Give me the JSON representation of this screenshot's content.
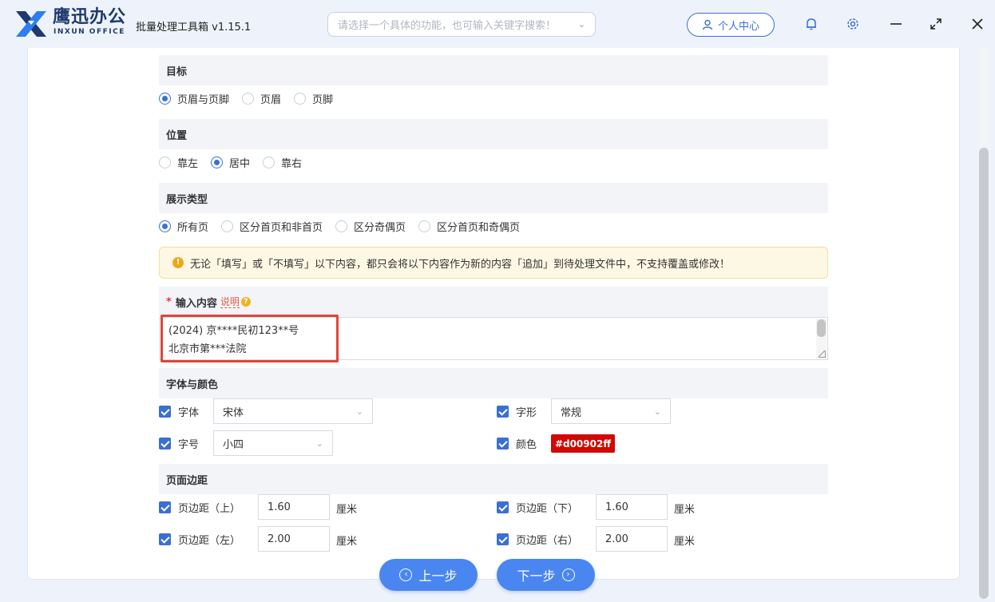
{
  "header": {
    "logo_cn": "鹰迅办公",
    "logo_en": "INXUN OFFICE",
    "app_name": "批量处理工具箱 v1.15.1",
    "search_placeholder": "请选择一个具体的功能，也可输入关键字搜索！",
    "user_center": "个人中心"
  },
  "target": {
    "title": "目标",
    "options": [
      "页眉与页脚",
      "页眉",
      "页脚"
    ],
    "selected": 0
  },
  "position": {
    "title": "位置",
    "options": [
      "靠左",
      "居中",
      "靠右"
    ],
    "selected": 1
  },
  "display_type": {
    "title": "展示类型",
    "options": [
      "所有页",
      "区分首页和非首页",
      "区分奇偶页",
      "区分首页和奇偶页"
    ],
    "selected": 0
  },
  "notice": "无论「填写」或「不填写」以下内容，都只会将以下内容作为新的内容「追加」到待处理文件中，不支持覆盖或修改！",
  "input_content": {
    "required_mark": "*",
    "title": "输入内容",
    "explain_link": "说明",
    "lines": [
      "(2024) 京****民初123**号",
      "北京市第***法院"
    ]
  },
  "font_color": {
    "title": "字体与颜色",
    "font_label": "字体",
    "font_value": "宋体",
    "style_label": "字形",
    "style_value": "常规",
    "size_label": "字号",
    "size_value": "小四",
    "color_label": "颜色",
    "color_value": "#d00902ff"
  },
  "margins": {
    "title": "页面边距",
    "top_label": "页边距（上）",
    "top_value": "1.60",
    "bottom_label": "页边距（下）",
    "bottom_value": "1.60",
    "left_label": "页边距（左）",
    "left_value": "2.00",
    "right_label": "页边距（右）",
    "right_value": "2.00",
    "unit": "厘米"
  },
  "footer": {
    "prev": "上一步",
    "next": "下一步"
  },
  "colors": {
    "accent": "#3a6fd8",
    "button": "#4a86f0",
    "highlight_box": "#e2443a",
    "chosen_color": "#d00902"
  }
}
